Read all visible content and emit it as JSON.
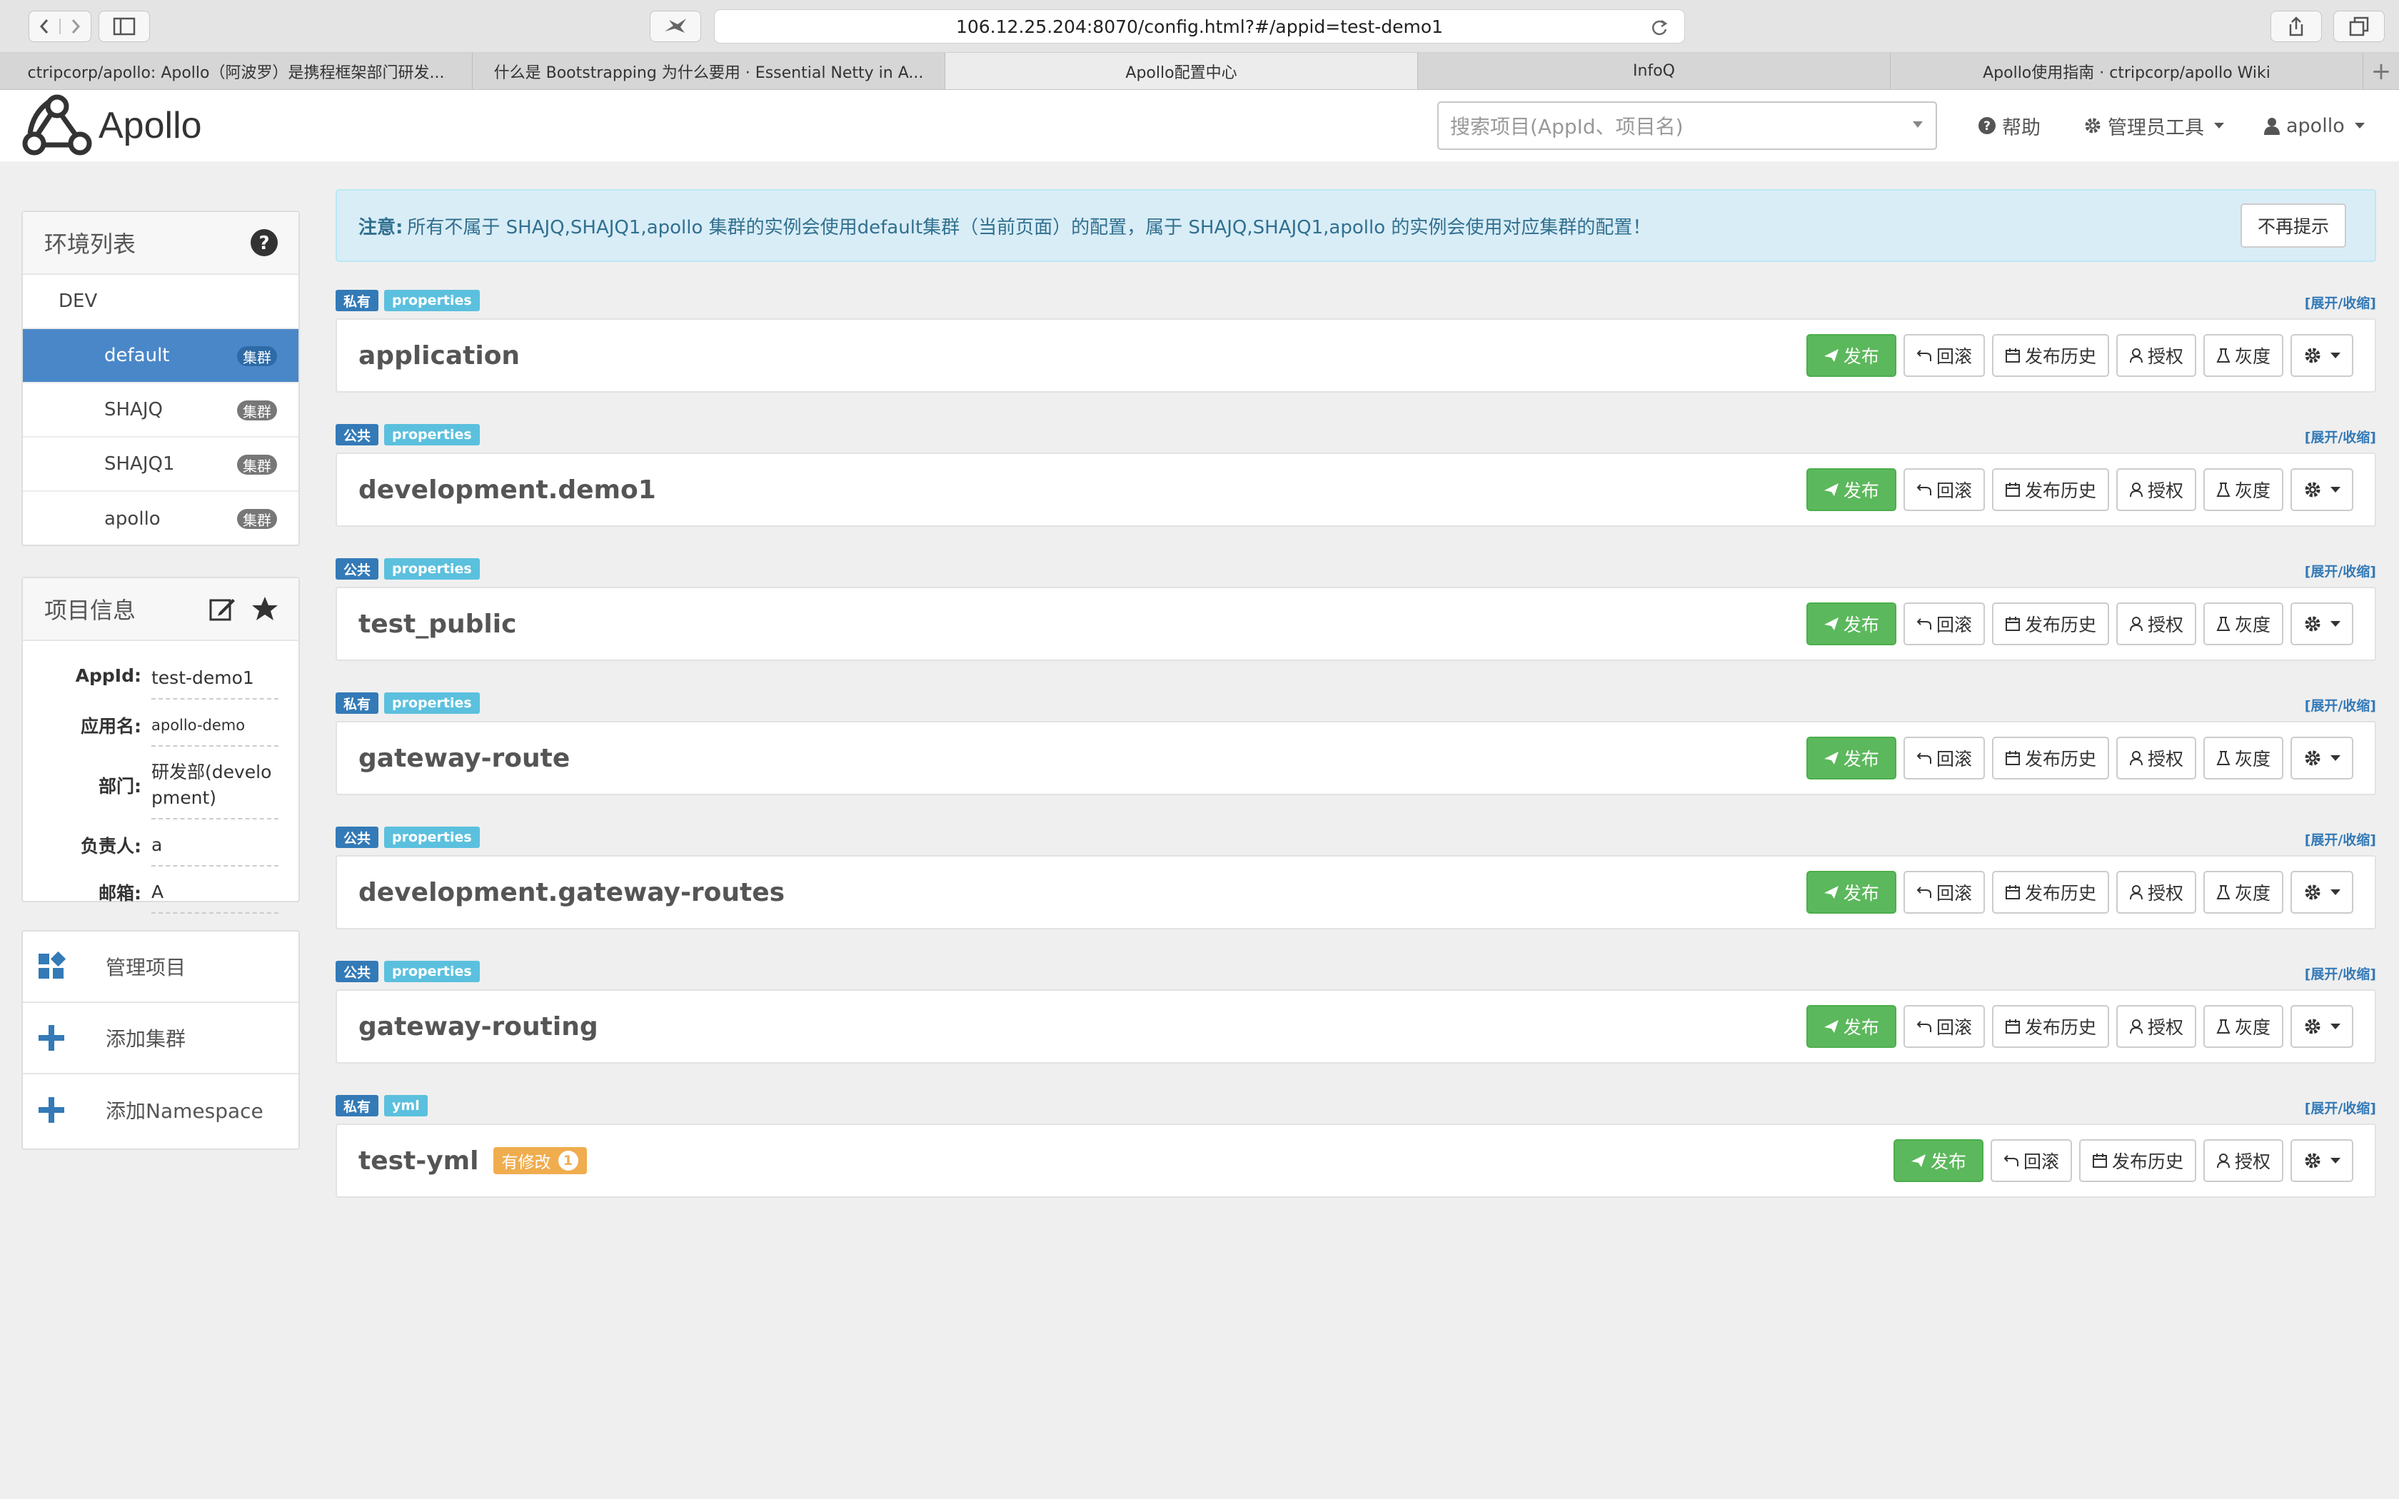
{
  "browser": {
    "url": "106.12.25.204:8070/config.html?#/appid=test-demo1",
    "tabs": [
      {
        "label": "ctripcorp/apollo: Apollo（阿波罗）是携程框架部门研发...",
        "active": false
      },
      {
        "label": "什么是 Bootstrapping 为什么要用 · Essential Netty in A...",
        "active": false
      },
      {
        "label": "Apollo配置中心",
        "active": true
      },
      {
        "label": "InfoQ",
        "active": false
      },
      {
        "label": "Apollo使用指南 · ctripcorp/apollo Wiki",
        "active": false
      }
    ]
  },
  "navbar": {
    "brand": "Apollo",
    "search_placeholder": "搜索项目(AppId、项目名)",
    "help": "帮助",
    "admin_tools": "管理员工具",
    "user": "apollo"
  },
  "env_panel": {
    "title": "环境列表",
    "env": "DEV",
    "clusters": [
      {
        "name": "default",
        "badge": "集群",
        "active": true
      },
      {
        "name": "SHAJQ",
        "badge": "集群",
        "active": false
      },
      {
        "name": "SHAJQ1",
        "badge": "集群",
        "active": false
      },
      {
        "name": "apollo",
        "badge": "集群",
        "active": false
      }
    ]
  },
  "info_panel": {
    "title": "项目信息",
    "rows": [
      {
        "label": "AppId:",
        "value": "test-demo1"
      },
      {
        "label": "应用名:",
        "value": "apollo-demo"
      },
      {
        "label": "部门:",
        "value": "研发部(development)"
      },
      {
        "label": "负责人:",
        "value": "a"
      },
      {
        "label": "邮箱:",
        "value": "A"
      }
    ]
  },
  "ops_panel": {
    "items": [
      {
        "label": "管理项目",
        "icon": "grid-icon"
      },
      {
        "label": "添加集群",
        "icon": "plus-icon"
      },
      {
        "label": "添加Namespace",
        "icon": "plus-icon"
      }
    ]
  },
  "notice": {
    "prefix": "注意:",
    "text": "所有不属于 SHAJQ,SHAJQ1,apollo 集群的实例会使用default集群（当前页面）的配置，属于 SHAJQ,SHAJQ1,apollo 的实例会使用对应集群的配置！",
    "button": "不再提示"
  },
  "namespace_common": {
    "toggle": "[展开/收缩]",
    "publish": "发布",
    "rollback": "回滚",
    "history": "发布历史",
    "grant": "授权",
    "gray": "灰度"
  },
  "namespaces": [
    {
      "scope": "私有",
      "format": "properties",
      "name": "application"
    },
    {
      "scope": "公共",
      "format": "properties",
      "name": "development.demo1"
    },
    {
      "scope": "公共",
      "format": "properties",
      "name": "test_public"
    },
    {
      "scope": "私有",
      "format": "properties",
      "name": "gateway-route"
    },
    {
      "scope": "公共",
      "format": "properties",
      "name": "development.gateway-routes"
    },
    {
      "scope": "公共",
      "format": "properties",
      "name": "gateway-routing"
    },
    {
      "scope": "私有",
      "format": "yml",
      "name": "test-yml",
      "modified_label": "有修改",
      "modified_count": "1"
    }
  ],
  "colors": {
    "primary": "#337ab7",
    "success": "#5cb85c",
    "info": "#5bc0de",
    "warning": "#f0ad4e",
    "active_cluster": "#4a87c8"
  }
}
